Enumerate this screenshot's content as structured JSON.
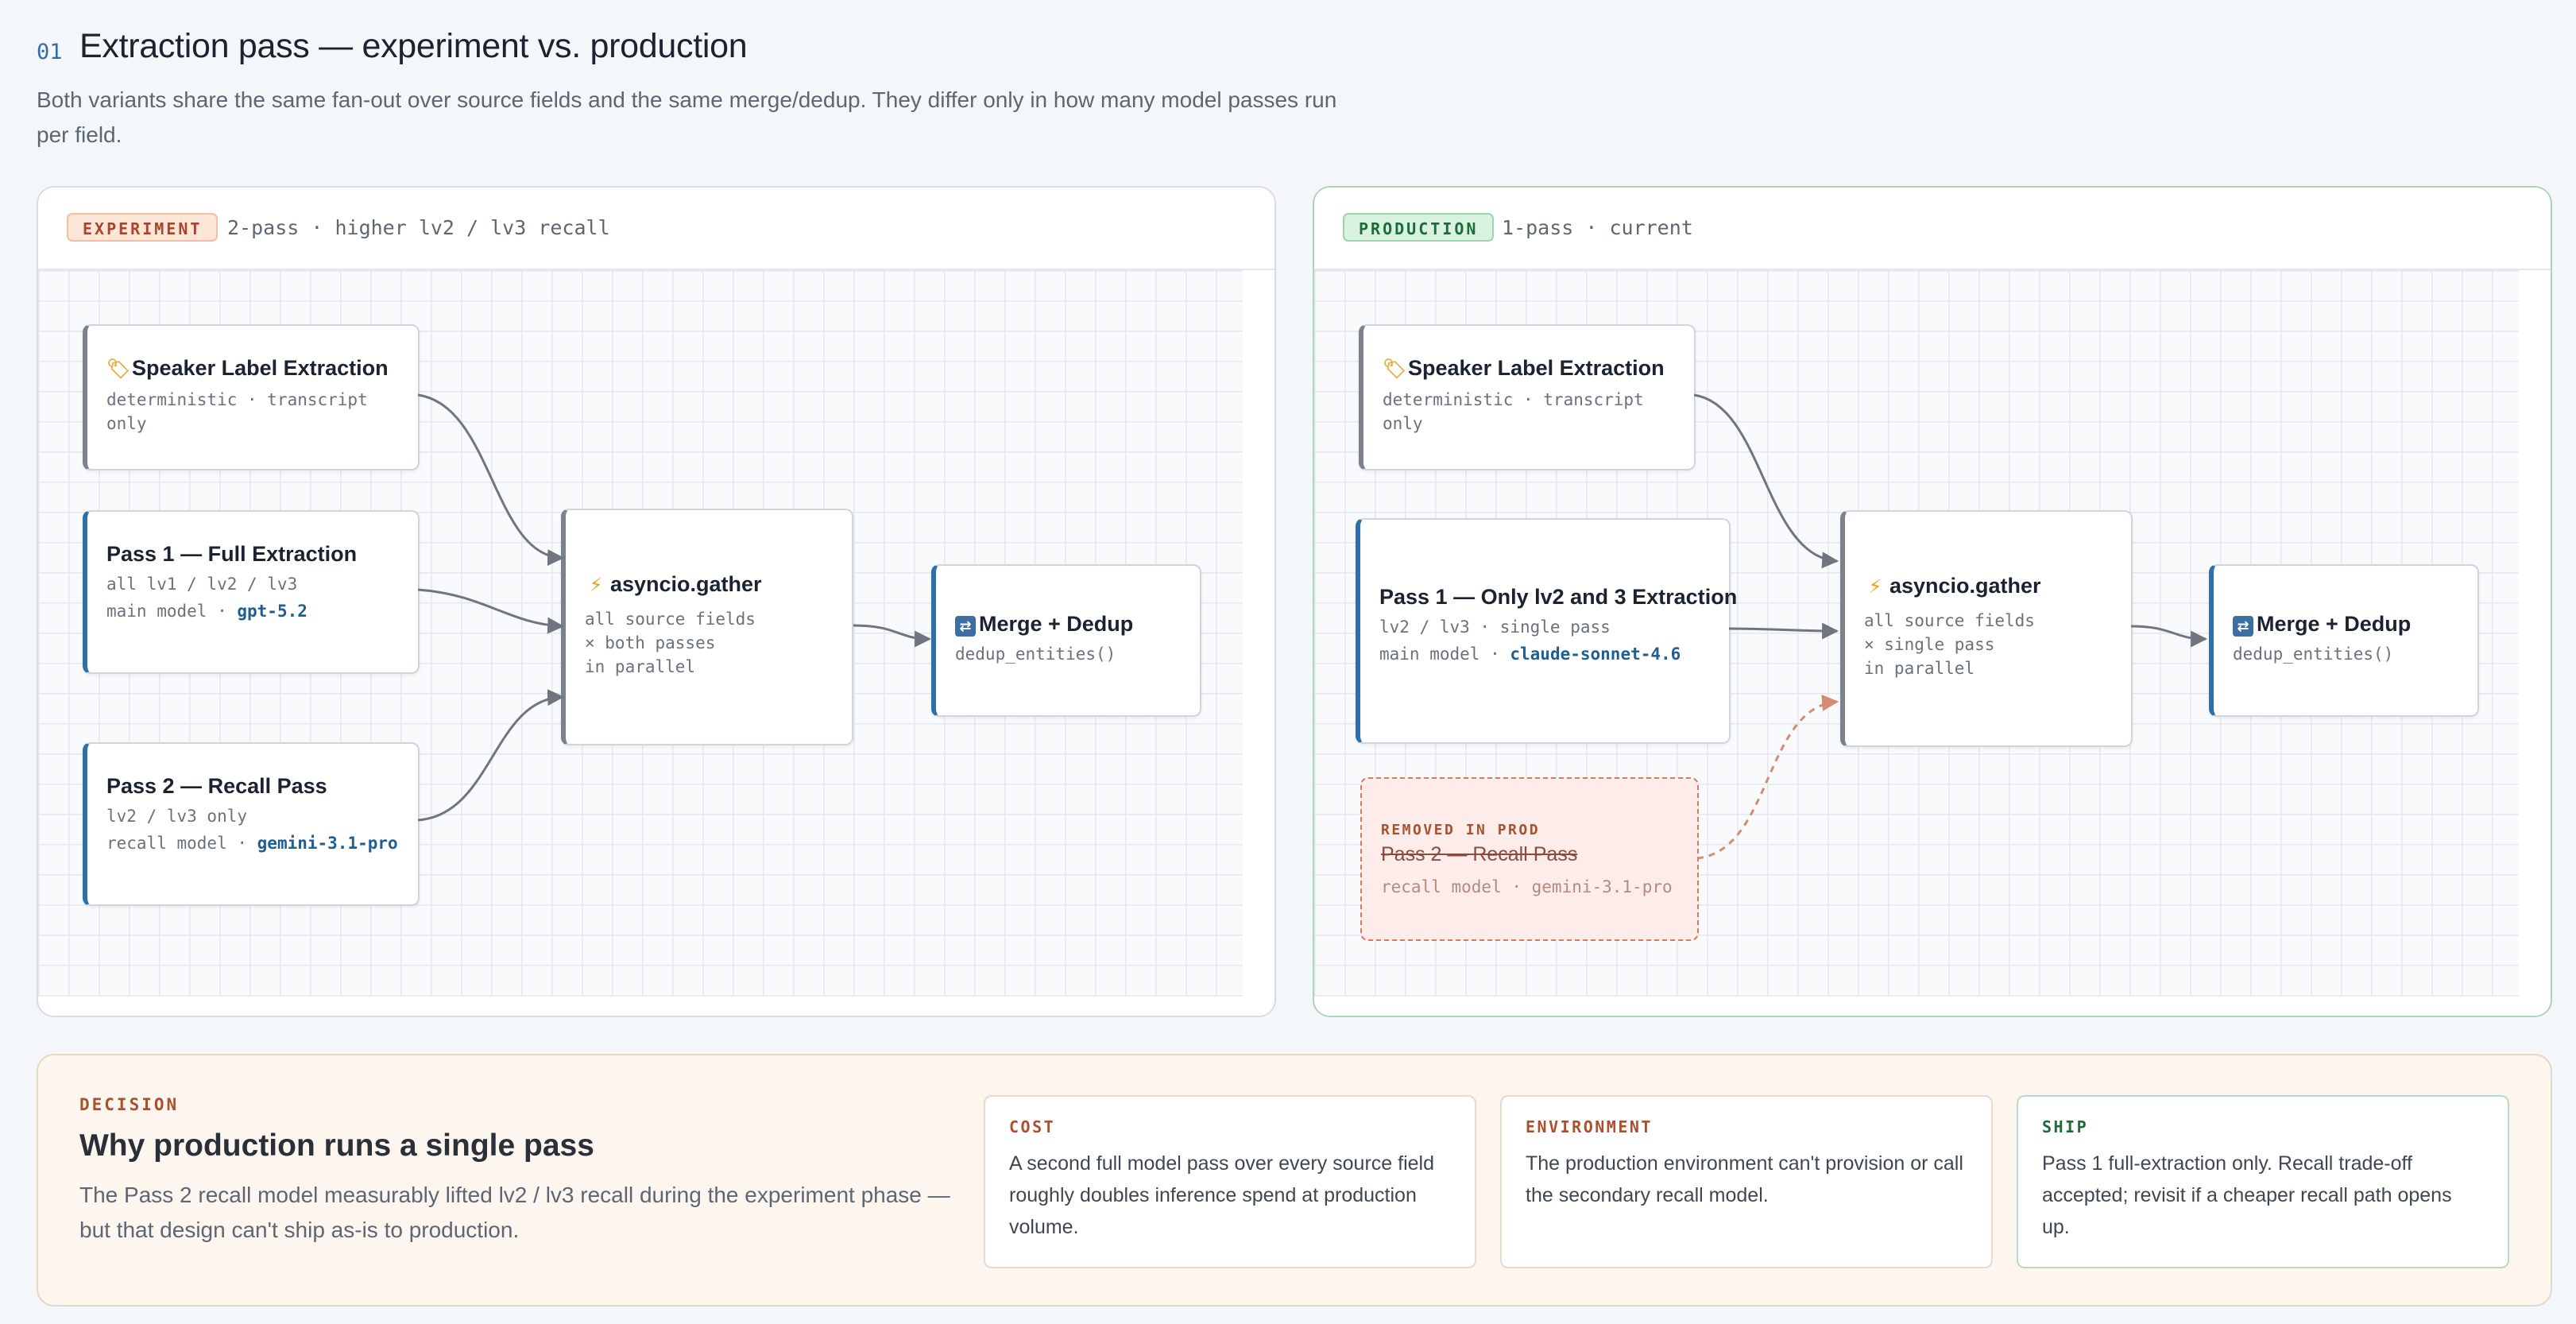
{
  "header": {
    "section_number": "01",
    "title": "Extraction pass — experiment vs. production",
    "subtitle": "Both variants share the same fan-out over source fields and the same merge/dedup. They differ only in how many model passes run per field."
  },
  "experiment": {
    "badge": "EXPERIMENT",
    "description": "2-pass · higher lv2 / lv3 recall",
    "nodes": {
      "speaker": {
        "title": "Speaker Label Extraction",
        "sub": "deterministic · transcript only",
        "icon": "label-tag-icon"
      },
      "pass1": {
        "title": "Pass 1 — Full Extraction",
        "sub": "all lv1 / lv2 / lv3",
        "model_prefix": "main model · ",
        "model": "gpt-5.2"
      },
      "pass2": {
        "title": "Pass 2 — Recall Pass",
        "sub": "lv2 / lv3 only",
        "model_prefix": "recall model · ",
        "model": "gemini-3.1-pro"
      },
      "gather": {
        "title": "asyncio.gather",
        "line1": "all source fields",
        "line2": "× both passes",
        "line3": "in parallel",
        "icon": "lightning-icon"
      },
      "merge": {
        "title": "Merge + Dedup",
        "sub": "dedup_entities()",
        "icon": "shuffle-icon"
      }
    }
  },
  "production": {
    "badge": "PRODUCTION",
    "description": "1-pass · current",
    "nodes": {
      "speaker": {
        "title": "Speaker Label Extraction",
        "sub": "deterministic · transcript only",
        "icon": "label-tag-icon"
      },
      "pass1": {
        "title": "Pass 1 — Only lv2 and 3 Extraction",
        "sub": "lv2 / lv3 · single pass",
        "model_prefix": "main model · ",
        "model": "claude-sonnet-4.6"
      },
      "removed": {
        "label": "REMOVED IN PROD",
        "title": "Pass 2 — Recall Pass",
        "sub": "recall model · gemini-3.1-pro"
      },
      "gather": {
        "title": "asyncio.gather",
        "line1": "all source fields",
        "line2": "× single pass",
        "line3": "in parallel",
        "icon": "lightning-icon"
      },
      "merge": {
        "title": "Merge + Dedup",
        "sub": "dedup_entities()",
        "icon": "shuffle-icon"
      }
    }
  },
  "decision": {
    "eyebrow": "DECISION",
    "title": "Why production runs a single pass",
    "body": "The Pass 2 recall model measurably lifted lv2 / lv3 recall during the experiment phase — but that design can't ship as-is to production.",
    "cards": [
      {
        "head": "COST",
        "body": "A second full model pass over every source field roughly doubles inference spend at production volume."
      },
      {
        "head": "ENVIRONMENT",
        "body": "The production environment can't provision or call the secondary recall model."
      },
      {
        "head": "SHIP",
        "body": "Pass 1 full-extraction only. Recall trade-off accepted; revisit if a cheaper recall path opens up."
      }
    ]
  },
  "colors": {
    "accent_blue": "#2f6fa8",
    "experiment_badge": "#fde5d8",
    "production_badge": "#d7f2df",
    "removed_border": "#d97a5d",
    "edge": "#6f7680"
  }
}
